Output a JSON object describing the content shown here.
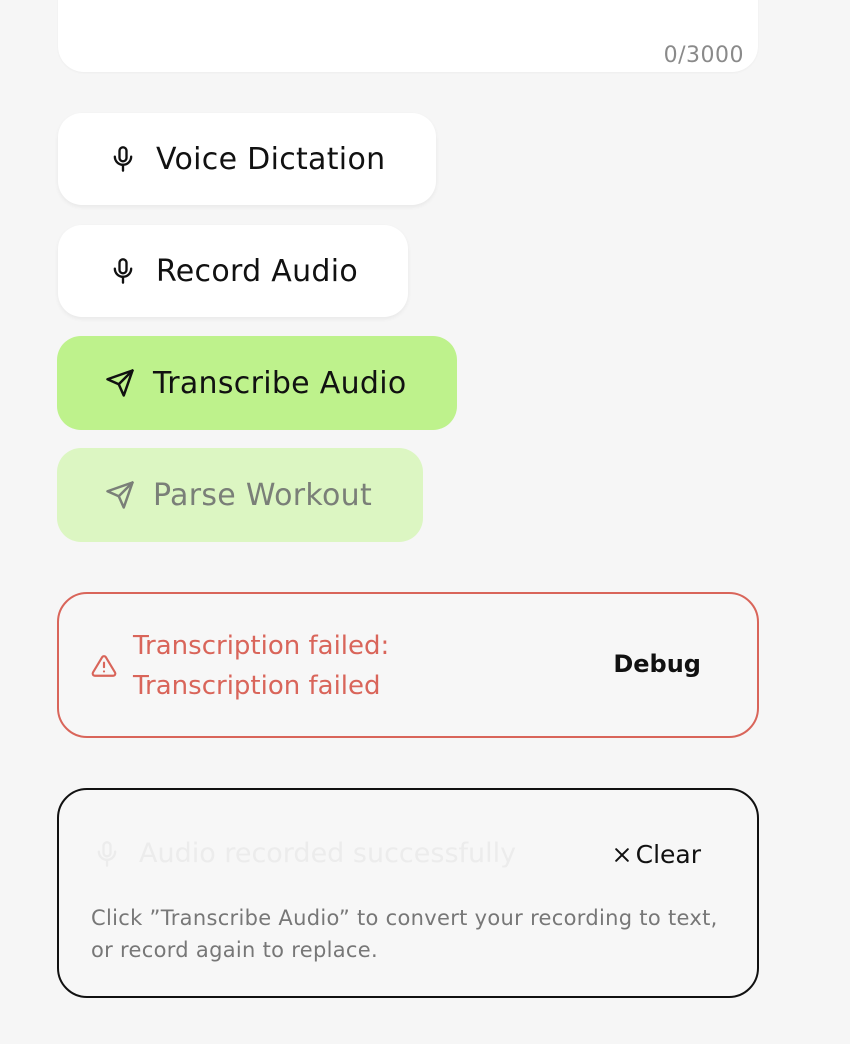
{
  "notes_field": {
    "char_count": "0/3000"
  },
  "actions": {
    "voice_dictation_label": "Voice Dictation",
    "record_audio_label": "Record Audio",
    "transcribe_audio_label": "Transcribe Audio",
    "parse_workout_label": "Parse Workout"
  },
  "error": {
    "message": "Transcription failed: Transcription failed",
    "debug_label": "Debug",
    "color": "#d9655a"
  },
  "audio_panel": {
    "status": "Audio recorded successfully",
    "clear_label": "Clear",
    "hint": "Click ”Transcribe Audio” to convert your recording to text, or record again to replace."
  },
  "colors": {
    "primary_button": "#bef28c",
    "disabled_button": "#dcf6c2",
    "background": "#f6f6f6"
  },
  "icons": {
    "voice_dictation": "microphone-icon",
    "record_audio": "microphone-icon",
    "transcribe_audio": "send-icon",
    "parse_workout": "send-icon",
    "error": "warning-icon",
    "audio_status": "microphone-icon",
    "clear": "close-icon"
  }
}
